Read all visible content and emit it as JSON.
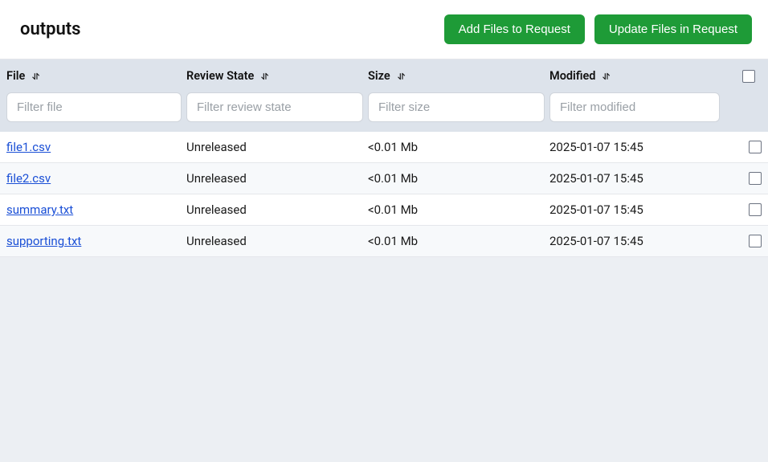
{
  "header": {
    "title": "outputs",
    "add_button": "Add Files to Request",
    "update_button": "Update Files in Request"
  },
  "columns": {
    "file": "File",
    "review": "Review State",
    "size": "Size",
    "modified": "Modified"
  },
  "filters": {
    "file_placeholder": "Filter file",
    "review_placeholder": "Filter review state",
    "size_placeholder": "Filter size",
    "modified_placeholder": "Filter modified"
  },
  "rows": [
    {
      "file": "file1.csv",
      "review": "Unreleased",
      "size": "<0.01 Mb",
      "modified": "2025-01-07 15:45"
    },
    {
      "file": "file2.csv",
      "review": "Unreleased",
      "size": "<0.01 Mb",
      "modified": "2025-01-07 15:45"
    },
    {
      "file": "summary.txt",
      "review": "Unreleased",
      "size": "<0.01 Mb",
      "modified": "2025-01-07 15:45"
    },
    {
      "file": "supporting.txt",
      "review": "Unreleased",
      "size": "<0.01 Mb",
      "modified": "2025-01-07 15:45"
    }
  ]
}
